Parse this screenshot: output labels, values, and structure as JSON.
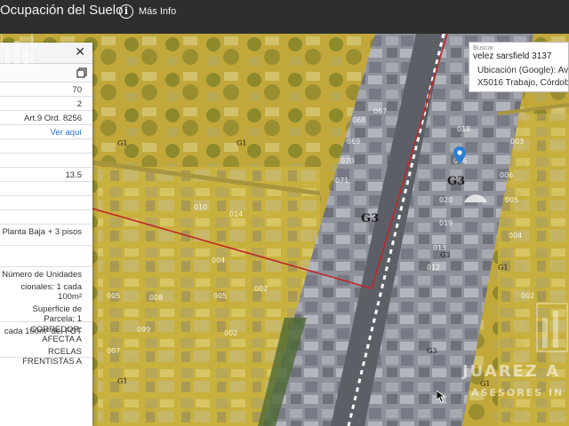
{
  "header": {
    "title": "Ocupación del Suelo",
    "info_label": "Más Info"
  },
  "panel": {
    "rows": [
      {
        "value": "70"
      },
      {
        "value": "2"
      },
      {
        "value": "Art.9 Ord. 8256"
      },
      {
        "value": "Ver aquí",
        "link": true
      },
      {
        "value": ""
      },
      {
        "value": ""
      },
      {
        "value": "13.5"
      },
      {
        "value": ""
      },
      {
        "value": ""
      },
      {
        "value": ""
      },
      {
        "value": "Planta Baja + 3 pisos"
      },
      {
        "value": ""
      },
      {
        "value": "Número de Unidades",
        "extra": [
          "cionales: 1 cada 100m²",
          "Superficie de Parcela; 1",
          "cada 100m² del FOT"
        ]
      },
      {
        "value": "CORREDOR: AFECTA A",
        "extra": [
          "RCELAS FRENTISTAS A"
        ]
      }
    ]
  },
  "search": {
    "label": "Buscar",
    "value": "velez sarsfield 3137"
  },
  "result": {
    "line1": "Ubicación (Google): Av. Vé",
    "line2": "X5016 Trabajo, Córdoba, A"
  },
  "map": {
    "zones": [
      {
        "label": "G1"
      },
      {
        "label": "G1"
      },
      {
        "label": "G3"
      },
      {
        "label": "G3"
      },
      {
        "label": "G3"
      },
      {
        "label": "G3"
      },
      {
        "label": "G1"
      },
      {
        "label": "G1"
      },
      {
        "label": "G1"
      }
    ],
    "parcels": [
      "067",
      "068",
      "069",
      "070",
      "071",
      "018",
      "016",
      "020",
      "019",
      "013",
      "012",
      "003",
      "006",
      "005",
      "004",
      "002",
      "014",
      "010",
      "002",
      "004",
      "005",
      "002",
      "005",
      "007",
      "008",
      "099"
    ],
    "colors": {
      "zone_g1": "#d8bf3a",
      "zone_g3": "#8a8f9c",
      "boundary": "#c0262a",
      "route": "#ffffff"
    }
  },
  "watermark": {
    "line1": "JUAREZ A",
    "line2": "ASESORES IN"
  }
}
